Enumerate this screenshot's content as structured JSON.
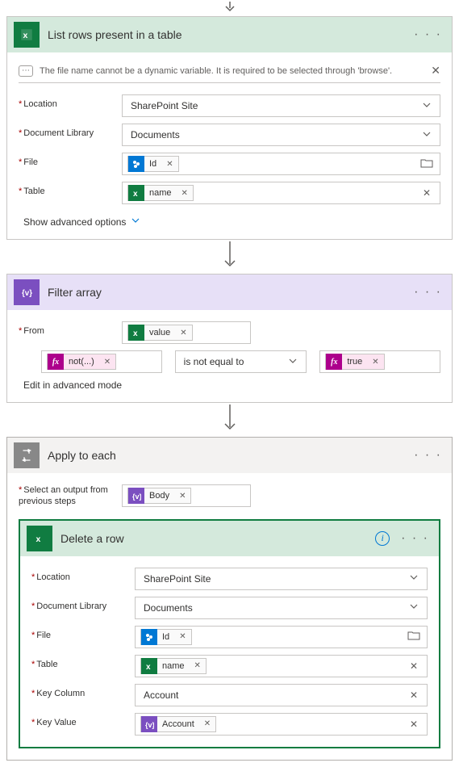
{
  "actions": {
    "listRows": {
      "title": "List rows present in a table",
      "info_msg": "The file name cannot be a dynamic variable. It is required to be selected through 'browse'.",
      "fields": {
        "location": {
          "label": "Location",
          "value": "SharePoint Site"
        },
        "library": {
          "label": "Document Library",
          "value": "Documents"
        },
        "file": {
          "label": "File",
          "token": "Id",
          "token_type": "sharepoint"
        },
        "table": {
          "label": "Table",
          "token": "name",
          "token_type": "excel"
        }
      },
      "advanced_label": "Show advanced options"
    },
    "filterArray": {
      "title": "Filter array",
      "from_label": "From",
      "from_token": "value",
      "left_token": "not(...)",
      "operator": "is not equal to",
      "right_token": "true",
      "edit_label": "Edit in advanced mode"
    },
    "applyEach": {
      "title": "Apply to each",
      "select_label": "Select an output from previous steps",
      "select_token": "Body"
    },
    "deleteRow": {
      "title": "Delete a row",
      "fields": {
        "location": {
          "label": "Location",
          "value": "SharePoint Site"
        },
        "library": {
          "label": "Document Library",
          "value": "Documents"
        },
        "file": {
          "label": "File",
          "token": "Id",
          "token_type": "sharepoint"
        },
        "table": {
          "label": "Table",
          "token": "name",
          "token_type": "excel"
        },
        "keyColumn": {
          "label": "Key Column",
          "value": "Account"
        },
        "keyValue": {
          "label": "Key Value",
          "token": "Account",
          "token_type": "purple"
        }
      }
    }
  }
}
